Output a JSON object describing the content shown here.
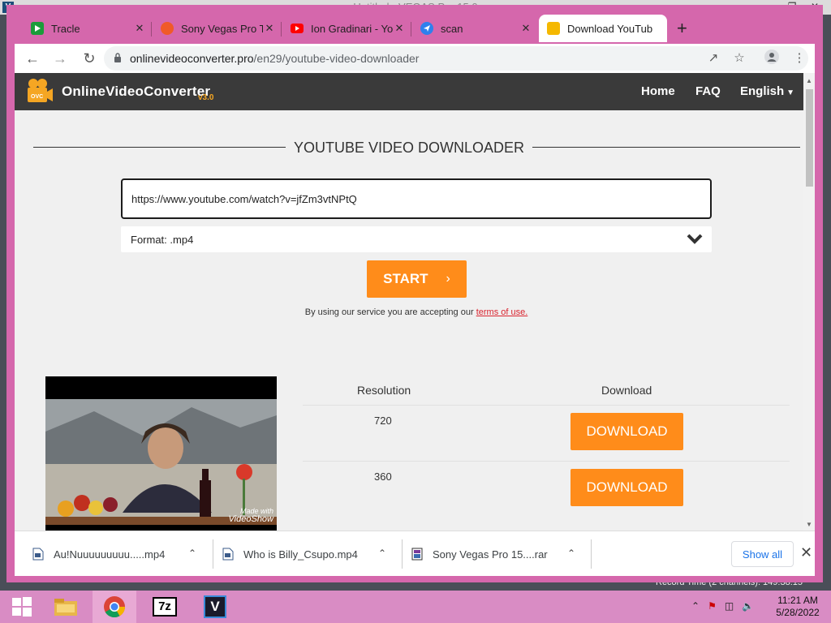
{
  "background_app": {
    "title": "Untitled - VEGAS Pro 15.0",
    "logo": "V",
    "record_text": "Record Time (2 channels): 149:38:15"
  },
  "browser": {
    "tabs": [
      {
        "title": "Tracle",
        "icon": "video-play-icon",
        "color": "#1a9c3a"
      },
      {
        "title": "Sony Vegas Pro Tu",
        "icon": "flame-icon",
        "color": "#f05a28"
      },
      {
        "title": "Ion Gradinari - Yo",
        "icon": "youtube-icon",
        "color": "#ff0000"
      },
      {
        "title": "scan",
        "icon": "paperplane-icon",
        "color": "#2f80ed"
      },
      {
        "title": "Download YouTub",
        "icon": "ovc-camera-icon",
        "color": "#f5b800",
        "active": true
      }
    ],
    "new_tab": "+",
    "url_host": "onlinevideoconverter.pro",
    "url_path": "/en29/youtube-video-downloader"
  },
  "site": {
    "logo_main": "OnlineVideoConverter",
    "logo_version": "v3.0",
    "logo_badge": "OVC",
    "nav": [
      "Home",
      "FAQ",
      "English"
    ],
    "heading": "YOUTUBE VIDEO DOWNLOADER",
    "url_value": "https://www.youtube.com/watch?v=jfZm3vtNPtQ",
    "format_label": "Format: .mp4",
    "start_label": "START",
    "terms_prefix": "By using our service you are accepting our",
    "terms_link": "terms of use.",
    "table_headers": {
      "resolution": "Resolution",
      "download": "Download"
    },
    "rows": [
      {
        "resolution": "720",
        "button": "DOWNLOAD"
      },
      {
        "resolution": "360",
        "button": "DOWNLOAD"
      }
    ],
    "watermark": "Made with",
    "watermark_brand": "VideoShow"
  },
  "downloads": {
    "items": [
      "Au!Nuuuuuuuuu.....mp4",
      "Who is Billy_Csupo.mp4",
      "Sony Vegas Pro 15....rar"
    ],
    "show_all": "Show all"
  },
  "taskbar": {
    "time": "11:21 AM",
    "date": "5/28/2022",
    "apps": [
      "windows-start-icon",
      "file-explorer-icon",
      "chrome-icon",
      "7zip-icon",
      "vegas-icon"
    ],
    "sevenzip_label": "7z",
    "vegas_label": "V"
  },
  "colors": {
    "chrome_frame": "#d567ac",
    "accent_orange": "#ff8c1a",
    "site_header": "#3a3a3a",
    "terms_link": "#d9232e"
  }
}
